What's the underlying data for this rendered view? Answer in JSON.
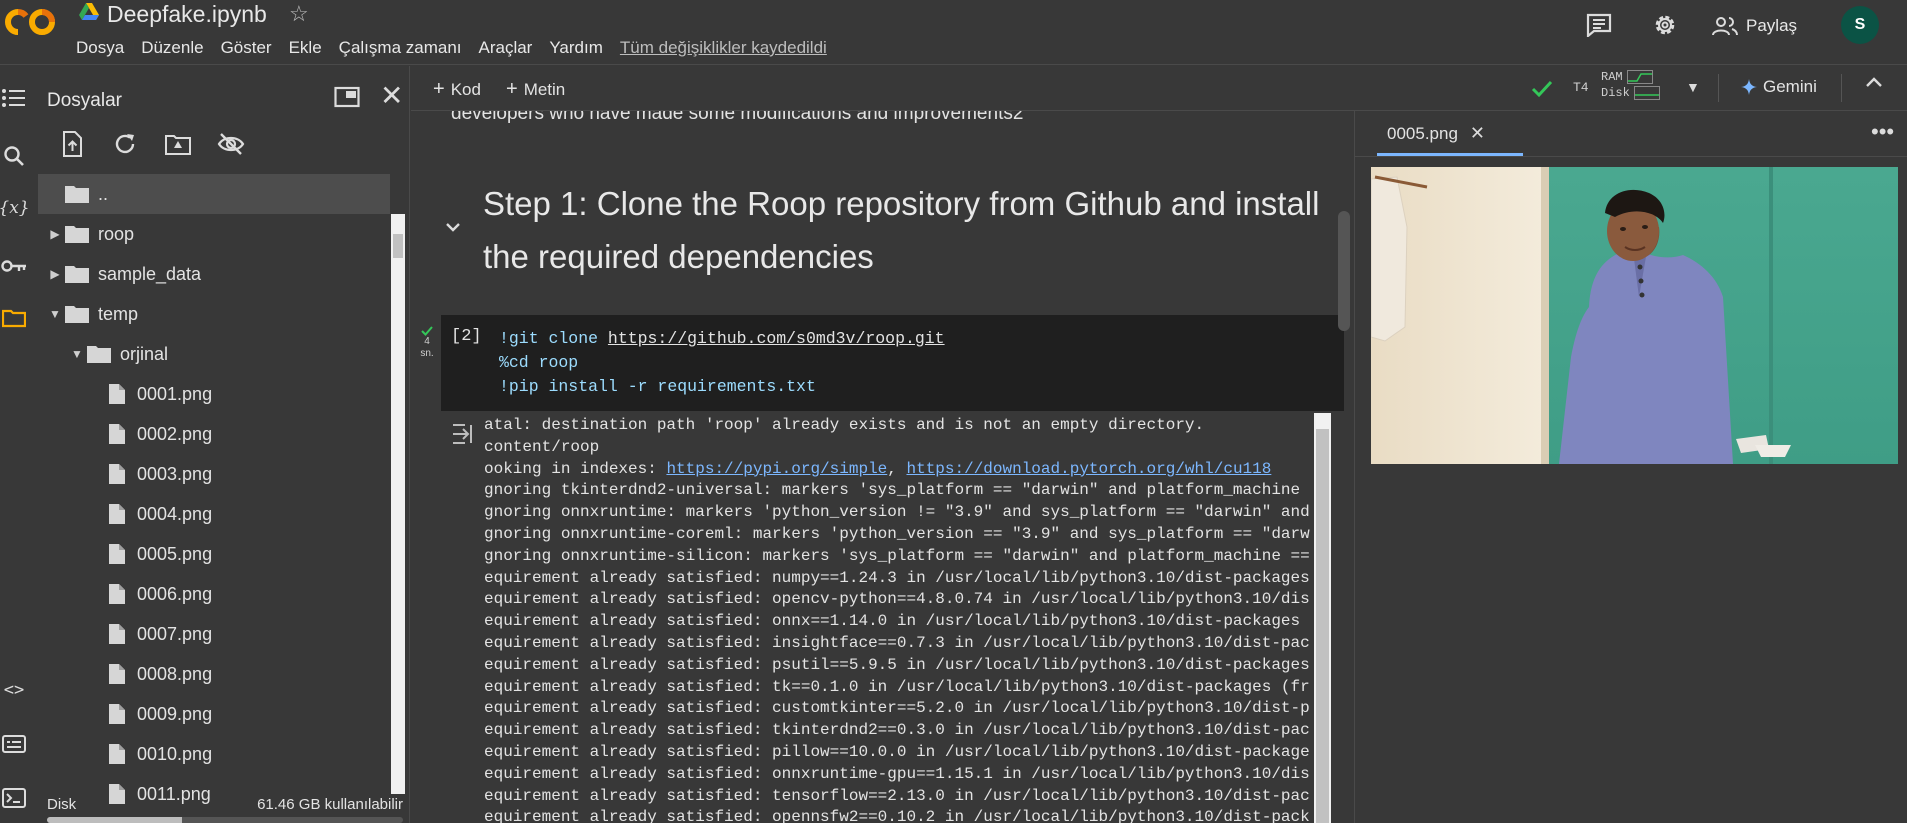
{
  "header": {
    "notebook_title": "Deepfake.ipynb",
    "menu": [
      "Dosya",
      "Düzenle",
      "Göster",
      "Ekle",
      "Çalışma zamanı",
      "Araçlar",
      "Yardım"
    ],
    "saved_status": "Tüm değişiklikler kaydedildi",
    "share_label": "Paylaş",
    "avatar_letter": "S"
  },
  "files_panel": {
    "title": "Dosyalar",
    "tree": [
      {
        "label": "..",
        "type": "folder",
        "depth": 0,
        "expanded": null,
        "selected": true
      },
      {
        "label": "roop",
        "type": "folder",
        "depth": 0,
        "expanded": false
      },
      {
        "label": "sample_data",
        "type": "folder",
        "depth": 0,
        "expanded": false
      },
      {
        "label": "temp",
        "type": "folder",
        "depth": 0,
        "expanded": true
      },
      {
        "label": "orjinal",
        "type": "folder",
        "depth": 1,
        "expanded": true
      },
      {
        "label": "0001.png",
        "type": "file",
        "depth": 2
      },
      {
        "label": "0002.png",
        "type": "file",
        "depth": 2
      },
      {
        "label": "0003.png",
        "type": "file",
        "depth": 2
      },
      {
        "label": "0004.png",
        "type": "file",
        "depth": 2
      },
      {
        "label": "0005.png",
        "type": "file",
        "depth": 2
      },
      {
        "label": "0006.png",
        "type": "file",
        "depth": 2
      },
      {
        "label": "0007.png",
        "type": "file",
        "depth": 2
      },
      {
        "label": "0008.png",
        "type": "file",
        "depth": 2
      },
      {
        "label": "0009.png",
        "type": "file",
        "depth": 2
      },
      {
        "label": "0010.png",
        "type": "file",
        "depth": 2
      },
      {
        "label": "0011.png",
        "type": "file",
        "depth": 2
      }
    ],
    "disk_label": "Disk",
    "disk_available": "61.46 GB kullanılabilir",
    "disk_used_fraction": 0.38
  },
  "notebook_toolbar": {
    "add_code_label": "Kod",
    "add_text_label": "Metin",
    "accelerator": "T4",
    "ram_label": "RAM",
    "disk_label": "Disk",
    "gemini_label": "Gemini"
  },
  "notebook": {
    "previous_text": "developers who have made some modifications and improvements2",
    "step_heading": "Step 1: Clone the Roop repository from Github and install the required dependencies",
    "run_status": [
      "4",
      "sn."
    ],
    "exec_count": "[2]",
    "code_lines": [
      {
        "prefix": "!git clone ",
        "url": "https://github.com/s0md3v/roop.git"
      },
      {
        "prefix": "%cd roop",
        "url": ""
      },
      {
        "prefix": "!pip install -r requirements.txt",
        "url": ""
      }
    ],
    "output_lines": [
      "atal: destination path 'roop' already exists and is not an empty directory.",
      "content/roop",
      "ooking in indexes: |https://pypi.org/simple|, |https://download.pytorch.org/whl/cu118|",
      "gnoring tkinterdnd2-universal: markers 'sys_platform == \"darwin\" and platform_machine",
      "gnoring onnxruntime: markers 'python_version != \"3.9\" and sys_platform == \"darwin\" and",
      "gnoring onnxruntime-coreml: markers 'python_version == \"3.9\" and sys_platform == \"darw",
      "gnoring onnxruntime-silicon: markers 'sys_platform == \"darwin\" and platform_machine ==",
      "equirement already satisfied: numpy==1.24.3 in /usr/local/lib/python3.10/dist-packages",
      "equirement already satisfied: opencv-python==4.8.0.74 in /usr/local/lib/python3.10/dis",
      "equirement already satisfied: onnx==1.14.0 in /usr/local/lib/python3.10/dist-packages",
      "equirement already satisfied: insightface==0.7.3 in /usr/local/lib/python3.10/dist-pac",
      "equirement already satisfied: psutil==5.9.5 in /usr/local/lib/python3.10/dist-packages",
      "equirement already satisfied: tk==0.1.0 in /usr/local/lib/python3.10/dist-packages (fr",
      "equirement already satisfied: customtkinter==5.2.0 in /usr/local/lib/python3.10/dist-p",
      "equirement already satisfied: tkinterdnd2==0.3.0 in /usr/local/lib/python3.10/dist-pac",
      "equirement already satisfied: pillow==10.0.0 in /usr/local/lib/python3.10/dist-package",
      "equirement already satisfied: onnxruntime-gpu==1.15.1 in /usr/local/lib/python3.10/dis",
      "equirement already satisfied: tensorflow==2.13.0 in /usr/local/lib/python3.10/dist-pac",
      "equirement already satisfied: opennsfw2==0.10.2 in /usr/local/lib/python3.10/dist-pack"
    ]
  },
  "viewer": {
    "tab_label": "0005.png"
  },
  "colors": {
    "accent_blue": "#7cb7ff",
    "check_green": "#34c759",
    "avatar_bg": "#0b5345",
    "code_bg": "#1f1f1f"
  }
}
